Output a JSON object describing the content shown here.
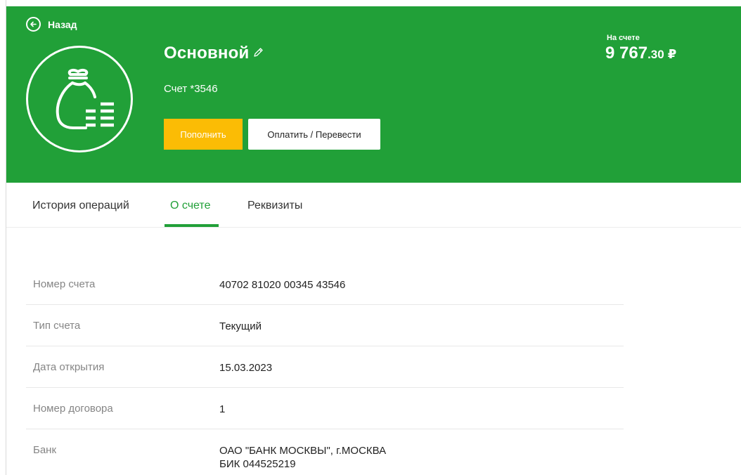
{
  "header": {
    "back_label": "Назад",
    "title": "Основной",
    "account_sub": "Счет *3546",
    "topup_label": "Пополнить",
    "pay_label": "Оплатить / Перевести",
    "balance_label": "На счете",
    "balance_int": "9 767",
    "balance_frac": ".30",
    "currency": "₽",
    "icons": {
      "back": "arrow-left-circle-icon",
      "edit": "pencil-icon",
      "logo": "money-bag-coins-icon"
    },
    "colors": {
      "brand": "#21a038",
      "accent": "#fbbc05"
    }
  },
  "tabs": [
    {
      "label": "История операций",
      "active": false
    },
    {
      "label": "О счете",
      "active": true
    },
    {
      "label": "Реквизиты",
      "active": false
    }
  ],
  "details": [
    {
      "label": "Номер счета",
      "value": "40702 81020 00345 43546"
    },
    {
      "label": "Тип счета",
      "value": "Текущий"
    },
    {
      "label": "Дата открытия",
      "value": "15.03.2023"
    },
    {
      "label": "Номер договора",
      "value": "1"
    },
    {
      "label": "Банк",
      "value": "ОАО \"БАНК МОСКВЫ\", г.МОСКВА",
      "value2": "БИК 044525219"
    }
  ]
}
